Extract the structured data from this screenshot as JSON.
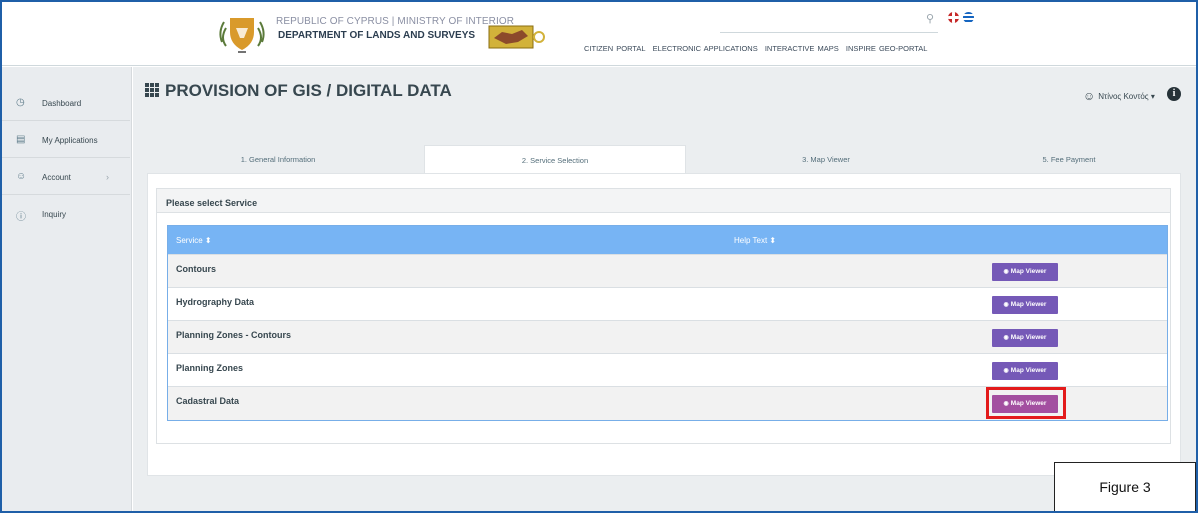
{
  "header": {
    "org_line1": "REPUBLIC OF CYPRUS | MINISTRY OF INTERIOR",
    "org_line2": "DEPARTMENT OF LANDS AND SURVEYS",
    "nav": [
      "CITIZEN PORTAL",
      "ELECTRONIC APPLICATIONS",
      "INTERACTIVE MAPS",
      "INSPIRE GEO-PORTAL"
    ],
    "icons": {
      "search": "search-icon",
      "flags": [
        "flag-uk-icon",
        "flag-gr-icon"
      ]
    }
  },
  "sidebar": {
    "items": [
      {
        "label": "Dashboard",
        "icon": "clock-icon"
      },
      {
        "label": "My Applications",
        "icon": "inbox-icon"
      },
      {
        "label": "Account",
        "icon": "user-icon"
      },
      {
        "label": "Inquiry",
        "icon": "help-icon"
      }
    ]
  },
  "main": {
    "title": "PROVISION OF GIS / DIGITAL DATA",
    "user_name": "Ντίνος Κοντός",
    "tabs": [
      {
        "label": "1. General Information",
        "active": false
      },
      {
        "label": "2. Service Selection",
        "active": true
      },
      {
        "label": "3. Map Viewer",
        "active": false
      },
      {
        "label": "5. Fee Payment",
        "active": false
      }
    ],
    "panel_title": "Please select Service",
    "table": {
      "columns": [
        "Service ⬍",
        "Help Text ⬍"
      ],
      "button_label": "Map Viewer",
      "rows": [
        {
          "service": "Contours",
          "help": ""
        },
        {
          "service": "Hydrography Data",
          "help": ""
        },
        {
          "service": "Planning Zones - Contours",
          "help": ""
        },
        {
          "service": "Planning Zones",
          "help": ""
        },
        {
          "service": "Cadastral Data",
          "help": ""
        }
      ],
      "highlighted_row": 4
    }
  },
  "figure_label": "Figure 3",
  "colors": {
    "accent_button": "#7559b7",
    "highlight_button": "#a34fa0",
    "highlight_border": "#e31b1b",
    "table_header": "#77b4f4"
  }
}
